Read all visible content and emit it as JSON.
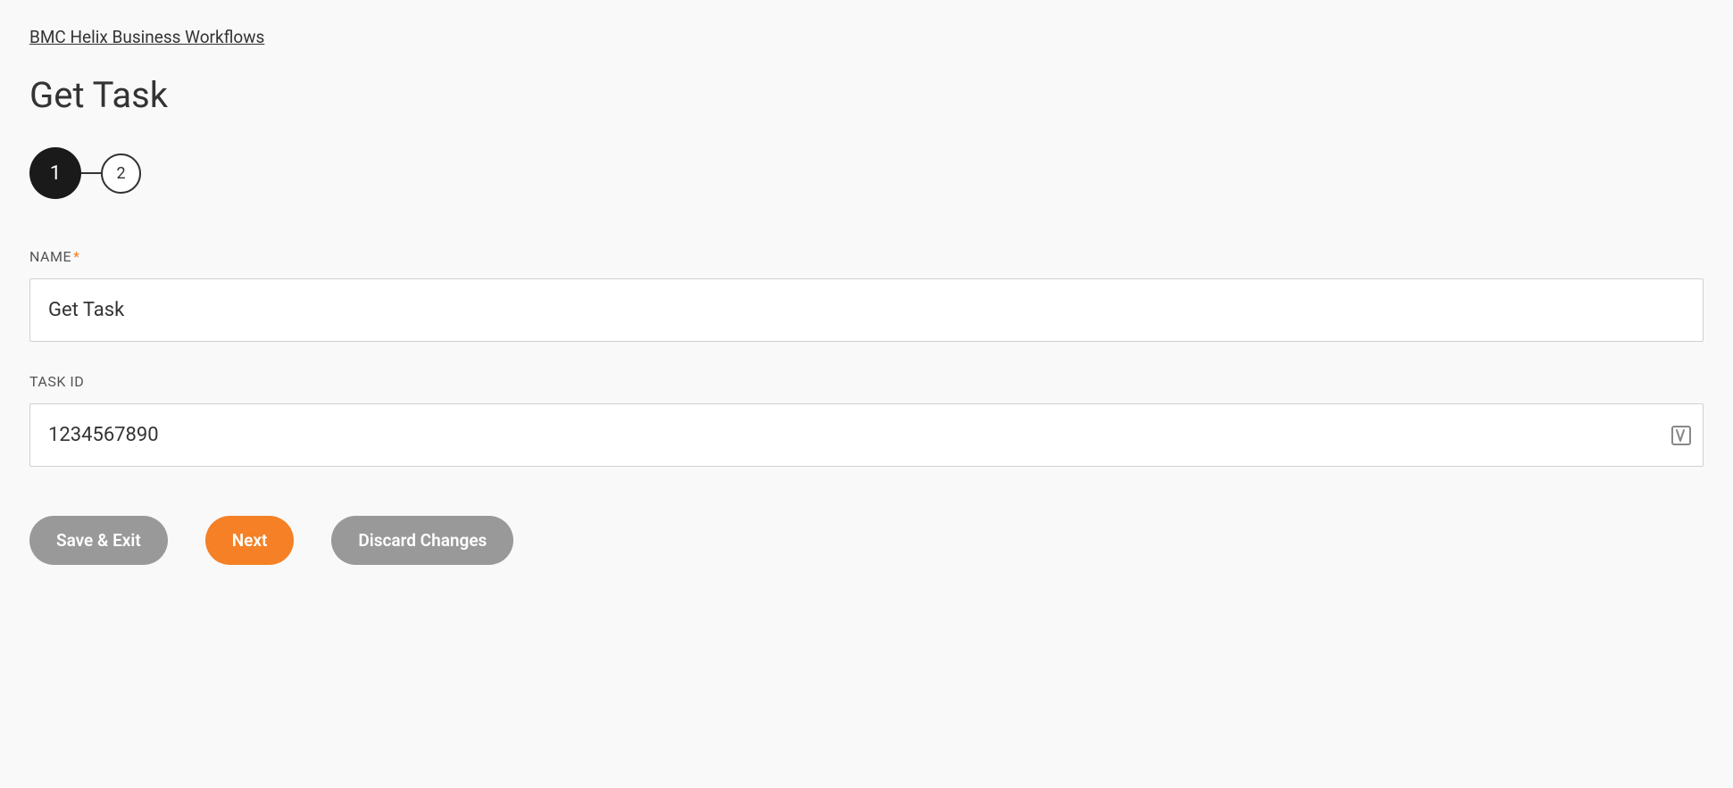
{
  "breadcrumb": {
    "label": "BMC Helix Business Workflows"
  },
  "page": {
    "title": "Get Task"
  },
  "wizard": {
    "steps": [
      {
        "number": "1",
        "active": true
      },
      {
        "number": "2",
        "active": false
      }
    ]
  },
  "form": {
    "name": {
      "label": "NAME",
      "required": true,
      "value": "Get Task"
    },
    "taskId": {
      "label": "TASK ID",
      "required": false,
      "value": "1234567890"
    }
  },
  "buttons": {
    "saveExit": "Save & Exit",
    "next": "Next",
    "discard": "Discard Changes"
  }
}
